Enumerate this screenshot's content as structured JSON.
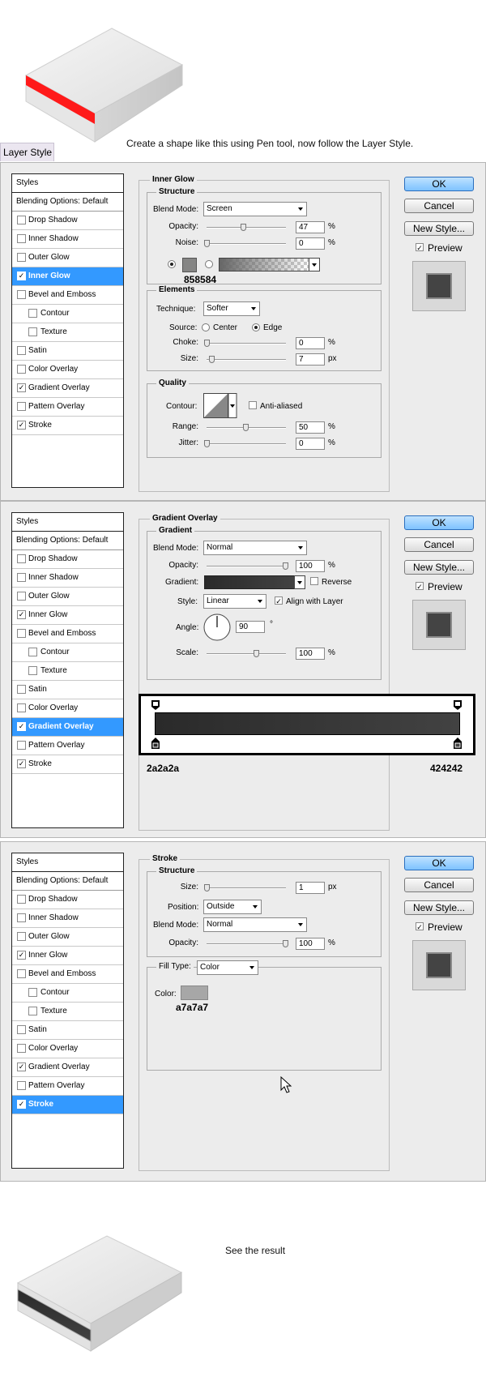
{
  "top_caption": "Create a shape like this using Pen tool, now follow the Layer Style.",
  "tab_title": "Layer Style",
  "styles_header": "Styles",
  "blending_options": "Blending Options: Default",
  "style_items": [
    "Drop Shadow",
    "Inner Shadow",
    "Outer Glow",
    "Inner Glow",
    "Bevel and Emboss",
    "Contour",
    "Texture",
    "Satin",
    "Color Overlay",
    "Gradient Overlay",
    "Pattern Overlay",
    "Stroke"
  ],
  "buttons": {
    "ok": "OK",
    "cancel": "Cancel",
    "new_style": "New Style...",
    "preview": "Preview"
  },
  "inner_glow": {
    "title": "Inner Glow",
    "structure": "Structure",
    "blend_mode_label": "Blend Mode:",
    "blend_mode": "Screen",
    "opacity_label": "Opacity:",
    "opacity": "47",
    "opacity_level": 0.47,
    "noise_label": "Noise:",
    "noise": "0",
    "color_hex": "858584",
    "color": "#858584",
    "elements": "Elements",
    "technique_label": "Technique:",
    "technique": "Softer",
    "source_label": "Source:",
    "center": "Center",
    "edge": "Edge",
    "choke_label": "Choke:",
    "choke": "0",
    "size_label": "Size:",
    "size": "7",
    "px": "px",
    "quality": "Quality",
    "contour_label": "Contour:",
    "anti_aliased": "Anti-aliased",
    "range_label": "Range:",
    "range": "50",
    "jitter_label": "Jitter:",
    "jitter": "0",
    "percent": "%"
  },
  "gradient_overlay": {
    "title": "Gradient Overlay",
    "gradient_section": "Gradient",
    "blend_mode_label": "Blend Mode:",
    "blend_mode": "Normal",
    "opacity_label": "Opacity:",
    "opacity": "100",
    "gradient_label": "Gradient:",
    "reverse": "Reverse",
    "style_label": "Style:",
    "style": "Linear",
    "align": "Align with Layer",
    "angle_label": "Angle:",
    "angle": "90",
    "degree": "°",
    "scale_label": "Scale:",
    "scale": "100",
    "percent": "%",
    "stop_left": "2a2a2a",
    "stop_right": "424242",
    "color_left": "#2a2a2a",
    "color_right": "#424242"
  },
  "stroke": {
    "title": "Stroke",
    "structure": "Structure",
    "size_label": "Size:",
    "size": "1",
    "px": "px",
    "position_label": "Position:",
    "position": "Outside",
    "blend_mode_label": "Blend Mode:",
    "blend_mode": "Normal",
    "opacity_label": "Opacity:",
    "opacity": "100",
    "percent": "%",
    "fill_type_label": "Fill Type:",
    "fill_type": "Color",
    "color_label": "Color:",
    "color_hex": "a7a7a7",
    "color": "#a7a7a7"
  },
  "bottom_caption": "See the result",
  "accent_red": "#ff1a1a",
  "highlight": "#3399ff"
}
